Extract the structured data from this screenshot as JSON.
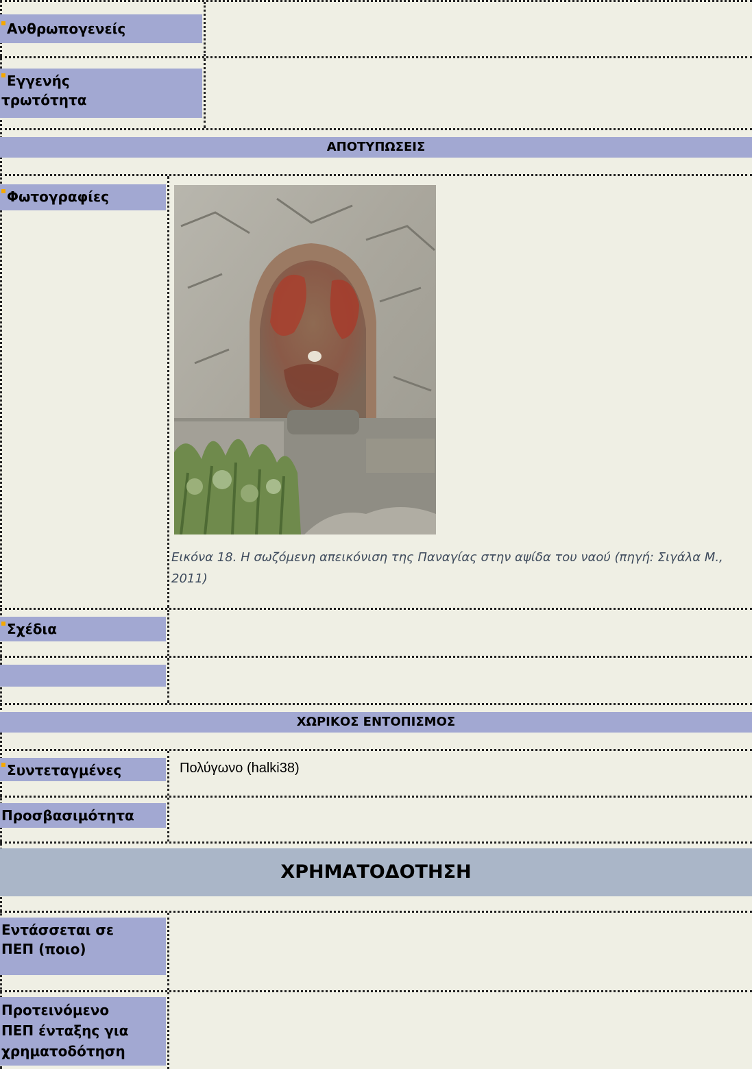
{
  "rows": {
    "anthropogenic": "Ανθρωπογενείς",
    "native_identity_1": "Εγγενής",
    "native_identity_2": "τρωτότητα",
    "photos": "Φωτογραφίες",
    "drawings": "Σχέδια",
    "coordinates": "Συντεταγμένες",
    "coordinates_value": "Πολύγωνο (halki38)",
    "accessibility": "Προσβασιμότητα",
    "pep_1": "Εντάσσεται σε",
    "pep_2": "ΠΕΠ (ποιο)",
    "proposed_1": "Προτεινόμενο",
    "proposed_2": "ΠΕΠ ένταξης για",
    "proposed_3": "χρηματοδότηση"
  },
  "sections": {
    "imprints": "ΑΠΟΤΥΠΩΣΕΙΣ",
    "spatial": "ΧΩΡΙΚΟΣ ΕΝΤΟΠΙΣΜΟΣ",
    "funding": "ΧΡΗΜΑΤΟΔΟΤΗΣΗ"
  },
  "photo_caption": "Εικόνα 18. Η σωζόμενη απεικόνιση της Παναγίας στην αψίδα του ναού (πηγή: Σιγάλα Μ., 2011)",
  "colors": {
    "label_bg": "#a2a8d2",
    "page_bg": "#efefe4",
    "bullet": "#f5a800",
    "funding_bg": "#aab6c8"
  }
}
